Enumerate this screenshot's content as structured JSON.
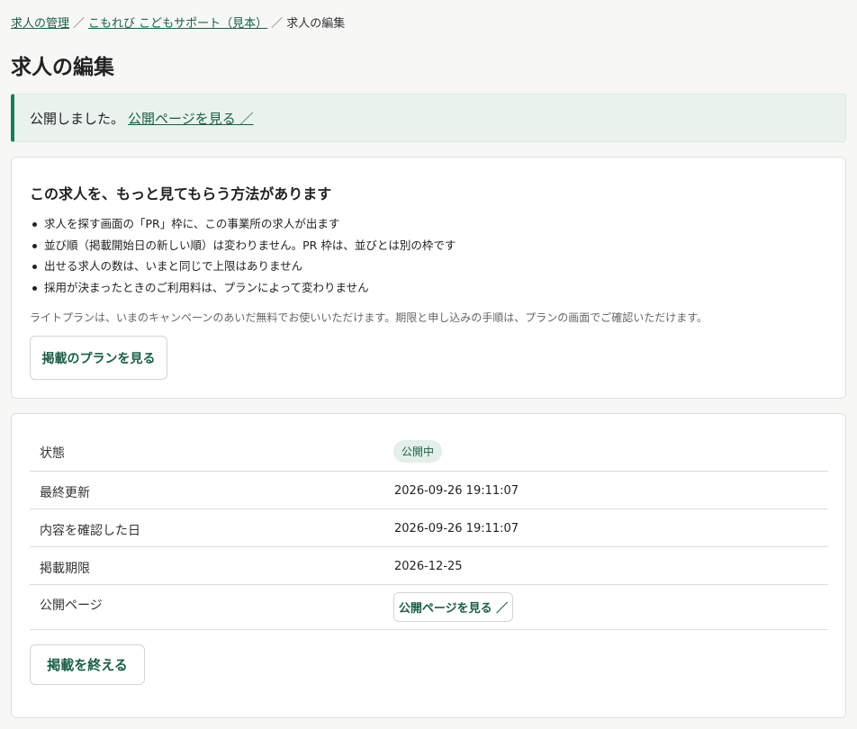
{
  "breadcrumb": {
    "items": [
      "求人の管理",
      "こもれび こどもサポート（見本）"
    ],
    "separator": "／",
    "current": "求人の編集"
  },
  "page": {
    "title": "求人の編集"
  },
  "flash": {
    "message": "公開しました。",
    "link_label": "公開ページを見る ／"
  },
  "promo": {
    "title": "この求人を、もっと見てもらう方法があります",
    "bullets": [
      "求人を探す画面の「PR」枠に、この事業所の求人が出ます",
      "並び順（掲載開始日の新しい順）は変わりません。PR 枠は、並びとは別の枠です",
      "出せる求人の数は、いまと同じで上限はありません",
      "採用が決まったときのご利用料は、プランによって変わりません"
    ],
    "note": "ライトプランは、いまのキャンペーンのあいだ無料でお使いいただけます。期限と申し込みの手順は、プランの画面でご確認いただけます。",
    "button_label": "掲載のプランを見る"
  },
  "info": {
    "rows": [
      {
        "label": "状態",
        "value": "公開中"
      },
      {
        "label": "最終更新",
        "value": "2026-09-26 19:11:07"
      },
      {
        "label": "内容を確認した日",
        "value": "2026-09-26 19:11:07"
      },
      {
        "label": "掲載期限",
        "value": "2026-12-25"
      },
      {
        "label": "公開ページ",
        "value": "公開ページを見る ／"
      }
    ],
    "end_button_label": "掲載を終える"
  },
  "colors": {
    "accent": "#1b5e45",
    "flash_border": "#1f7a55",
    "flash_background": "#eaf2ee",
    "badge_background": "#e4efe9",
    "page_background": "#f7f7f6"
  }
}
